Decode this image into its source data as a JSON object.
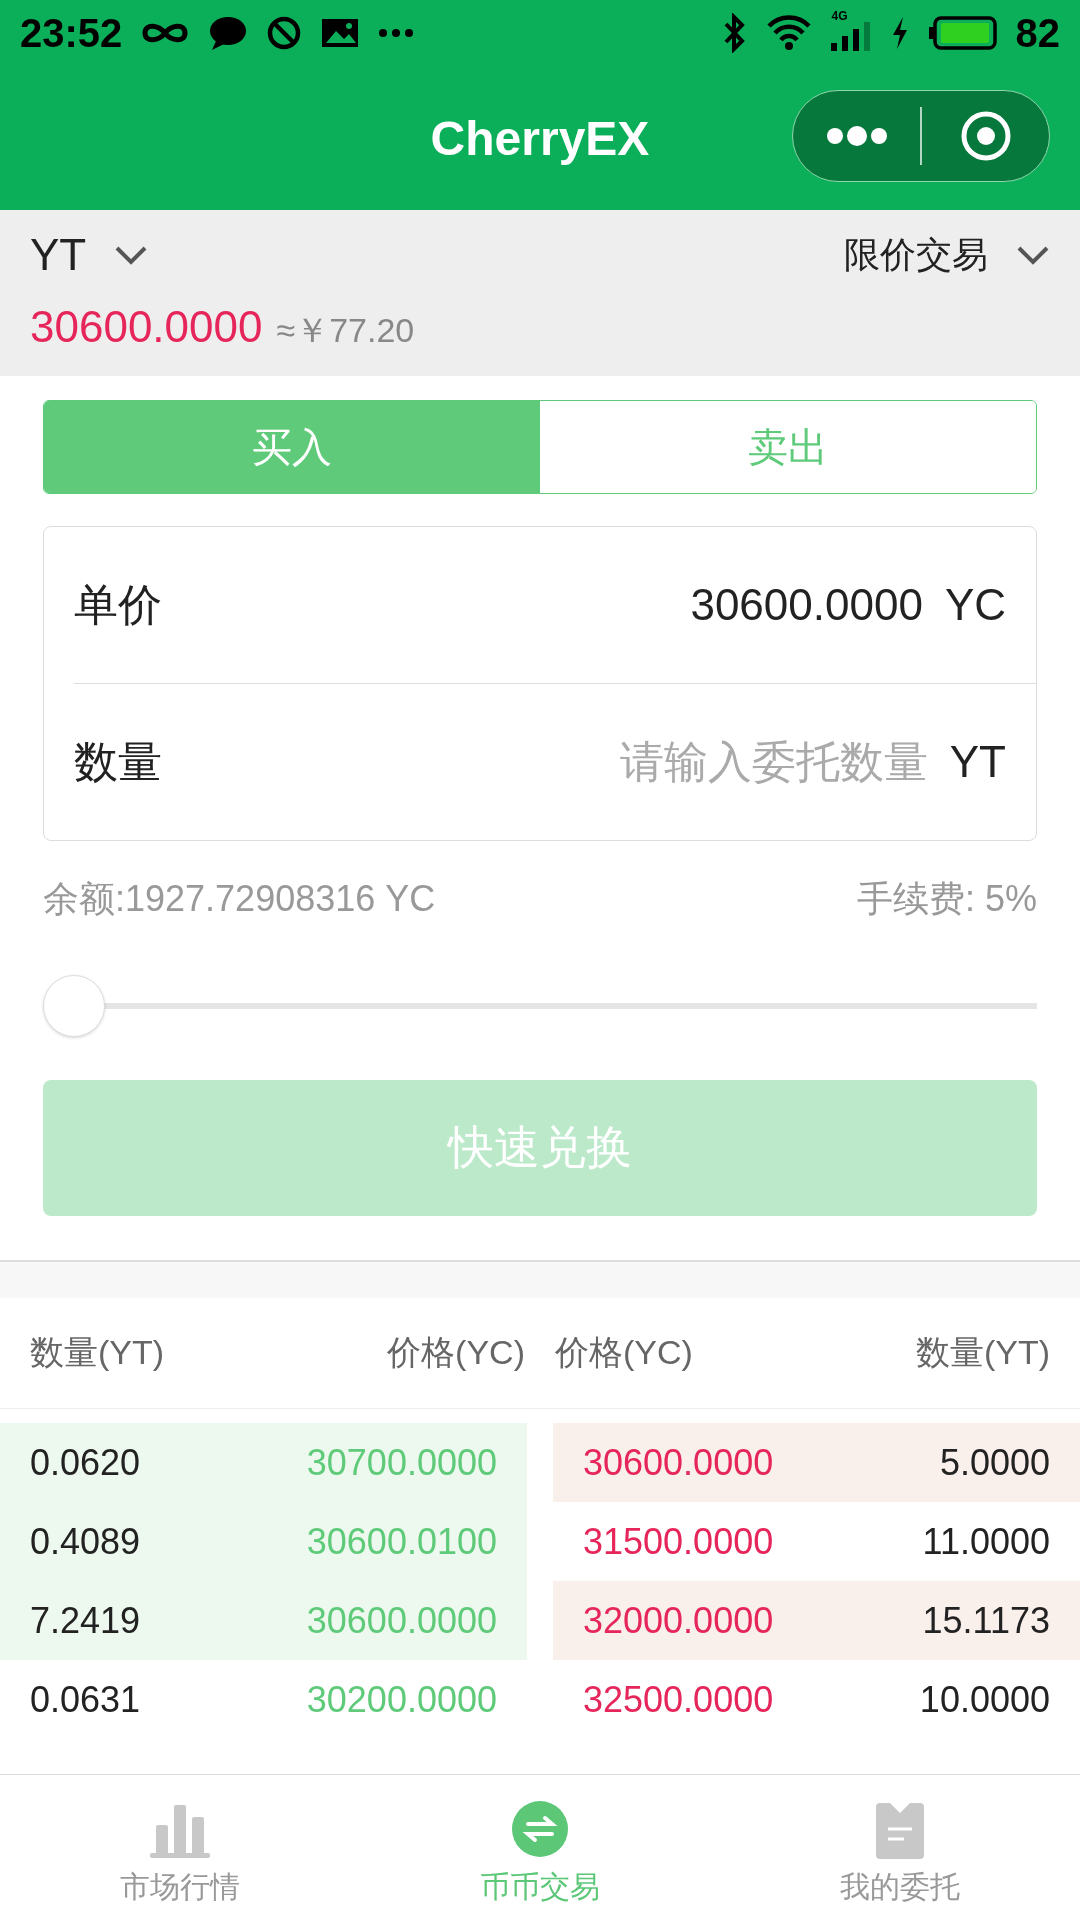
{
  "status_bar": {
    "time": "23:52",
    "network": "4G",
    "battery": "82"
  },
  "header": {
    "title": "CherryEX"
  },
  "market": {
    "symbol": "YT",
    "mode": "限价交易",
    "price": "30600.0000",
    "approx": "≈￥77.20"
  },
  "trade_tabs": [
    {
      "label": "买入",
      "selected": true
    },
    {
      "label": "卖出",
      "selected": false
    }
  ],
  "form": {
    "fields": [
      {
        "label": "单价",
        "value": "30600.0000",
        "unit": "YC"
      },
      {
        "label": "数量",
        "placeholder": "请输入委托数量",
        "unit": "YT"
      }
    ],
    "balance": "余额:1927.72908316 YC",
    "fee": "手续费: 5%",
    "slider": {
      "level": 0
    },
    "submit": {
      "label": "快速兑换",
      "disabled": true
    }
  },
  "order_book": {
    "columns": [
      "数量(YT)",
      "价格(YC)",
      "价格(YC)",
      "数量(YT)"
    ],
    "rows": [
      {
        "bid_amount": "0.0620",
        "bid_price": "30700.0000",
        "bid_highlight": true,
        "ask_price": "30600.0000",
        "ask_amount": "5.0000",
        "ask_highlight": true
      },
      {
        "bid_amount": "0.4089",
        "bid_price": "30600.0100",
        "bid_highlight": true,
        "ask_price": "31500.0000",
        "ask_amount": "11.0000",
        "ask_highlight": false
      },
      {
        "bid_amount": "7.2419",
        "bid_price": "30600.0000",
        "bid_highlight": true,
        "ask_price": "32000.0000",
        "ask_amount": "15.1173",
        "ask_highlight": true
      },
      {
        "bid_amount": "0.0631",
        "bid_price": "30200.0000",
        "bid_highlight": false,
        "ask_price": "32500.0000",
        "ask_amount": "10.0000",
        "ask_highlight": false
      }
    ]
  },
  "tab_bar": [
    {
      "label": "市场行情",
      "kind": "chart",
      "selected": false
    },
    {
      "label": "币币交易",
      "kind": "exchange",
      "selected": true
    },
    {
      "label": "我的委托",
      "kind": "clipboard",
      "selected": false
    }
  ]
}
